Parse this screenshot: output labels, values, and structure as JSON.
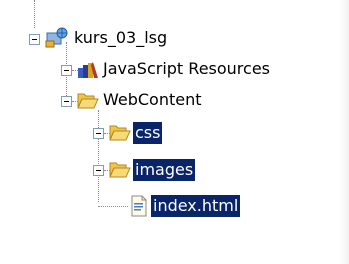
{
  "tree": {
    "project": {
      "label": "kurs_03_lsg",
      "icon": "project-web-icon",
      "expanded": true
    },
    "items": [
      {
        "label": "JavaScript Resources",
        "icon": "library-icon",
        "expanded": false,
        "level": 1,
        "selected": false
      },
      {
        "label": "WebContent",
        "icon": "folder-open-icon",
        "expanded": true,
        "level": 1,
        "selected": false
      },
      {
        "label": "css",
        "icon": "folder-icon",
        "expanded": false,
        "level": 2,
        "selected": true
      },
      {
        "label": "images",
        "icon": "folder-icon",
        "expanded": false,
        "level": 2,
        "selected": true
      },
      {
        "label": "index.html",
        "icon": "html-file-icon",
        "level": 2,
        "selected": true
      }
    ]
  },
  "colors": {
    "selection_bg": "#0a246a",
    "selection_fg": "#ffffff",
    "folder": "#f5c842",
    "toggle_border": "#7f9db9"
  }
}
